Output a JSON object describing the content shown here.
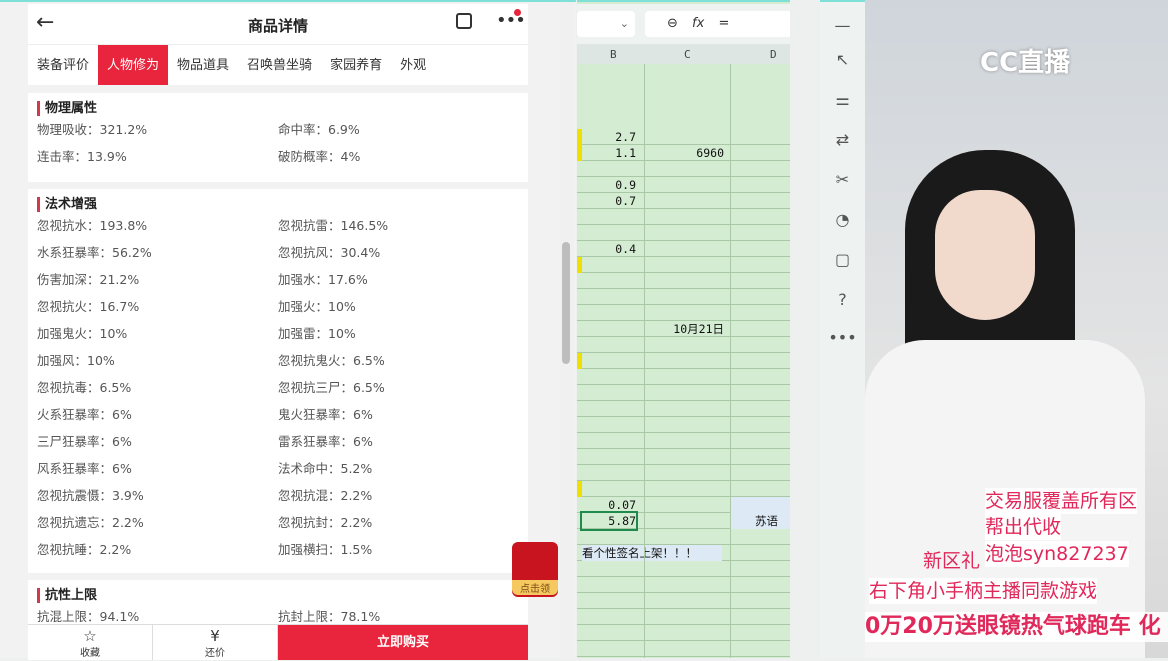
{
  "header": {
    "title": "商品详情",
    "back_icon": "arrow-left",
    "share_icon": "share",
    "more_icon": "more"
  },
  "tabs": [
    {
      "label": "装备评价"
    },
    {
      "label": "人物修为",
      "active": true
    },
    {
      "label": "物品道具"
    },
    {
      "label": "召唤兽坐骑"
    },
    {
      "label": "家园养育"
    },
    {
      "label": "外观"
    }
  ],
  "sections": [
    {
      "title": "物理属性",
      "items": [
        "物理吸收：321.2%",
        "命中率：6.9%",
        "连击率：13.9%",
        "破防概率：4%"
      ]
    },
    {
      "title": "法术增强",
      "items": [
        "忽视抗水：193.8%",
        "忽视抗雷：146.5%",
        "水系狂暴率：56.2%",
        "忽视抗风：30.4%",
        "伤害加深：21.2%",
        "加强水：17.6%",
        "忽视抗火：16.7%",
        "加强火：10%",
        "加强鬼火：10%",
        "加强雷：10%",
        "加强风：10%",
        "忽视抗鬼火：6.5%",
        "忽视抗毒：6.5%",
        "忽视抗三尸：6.5%",
        "火系狂暴率：6%",
        "鬼火狂暴率：6%",
        "三尸狂暴率：6%",
        "雷系狂暴率：6%",
        "风系狂暴率：6%",
        "法术命中：5.2%",
        "忽视抗震慑：3.9%",
        "忽视抗混：2.2%",
        "忽视抗遗忘：2.2%",
        "忽视抗封：2.2%",
        "忽视抗睡：2.2%",
        "加强横扫：1.5%"
      ]
    },
    {
      "title": "抗性上限",
      "items": [
        "抗混上限：94.1%",
        "抗封上限：78.1%"
      ]
    }
  ],
  "bottom": {
    "favorite": "收藏",
    "bargain": "还价",
    "buy": "立即购买"
  },
  "gift_label": "点击领",
  "sheet": {
    "columns": [
      "B",
      "C",
      "D"
    ],
    "formula_eq": "=",
    "formula_fx": "fx",
    "cells": [
      {
        "row": 0,
        "col": "B",
        "v": "2.7"
      },
      {
        "row": 1,
        "col": "B",
        "v": "1.1"
      },
      {
        "row": 1,
        "col": "C",
        "v": "6960"
      },
      {
        "row": 3,
        "col": "B",
        "v": "0.9"
      },
      {
        "row": 4,
        "col": "B",
        "v": "0.7"
      },
      {
        "row": 7,
        "col": "B",
        "v": "0.4"
      },
      {
        "row": 12,
        "col": "C",
        "v": "10月21日"
      },
      {
        "row": 23,
        "col": "B",
        "v": "0.07"
      },
      {
        "row": 24,
        "col": "B",
        "v": "5.87"
      },
      {
        "row": 24,
        "col": "D",
        "v": "苏语"
      },
      {
        "row": 26,
        "col": "B",
        "v": "看个性签名上架！！！"
      }
    ]
  },
  "stream": {
    "logo": "CC直播",
    "overlay": [
      "交易服覆盖所有区",
      "帮出代收",
      "泡泡syn827237",
      "新区礼",
      "右下角小手柄主播同款游戏",
      "0万20万送眼镜热气球跑车  化"
    ]
  }
}
